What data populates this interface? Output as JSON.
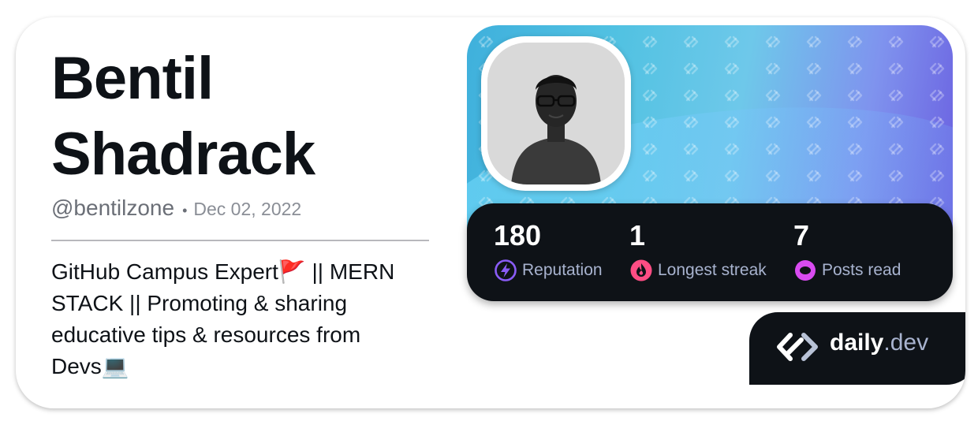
{
  "profile": {
    "name_line1": "Bentil",
    "name_line2": "Shadrack",
    "handle": "@bentilzone",
    "separator": "•",
    "join_date": "Dec 02, 2022",
    "bio_line1": "GitHub Campus Expert🚩 || MERN",
    "bio_line2": "STACK || Promoting & sharing",
    "bio_line3": "educative tips & resources from",
    "bio_line4": "Devs💻"
  },
  "stats": [
    {
      "value": "180",
      "label": "Reputation",
      "icon": "lightning-icon",
      "color": "#8a5cf6"
    },
    {
      "value": "1",
      "label": "Longest streak",
      "icon": "flame-icon",
      "color": "#ff4d84"
    },
    {
      "value": "7",
      "label": "Posts read",
      "icon": "ring-icon",
      "color": "#d84bf0"
    }
  ],
  "brand": {
    "daily": "daily",
    "dev": ".dev"
  },
  "colors": {
    "text": "#0e1217",
    "muted": "#6b6f77",
    "panel": "#0e1217",
    "stat_label": "#a8b3cf"
  }
}
